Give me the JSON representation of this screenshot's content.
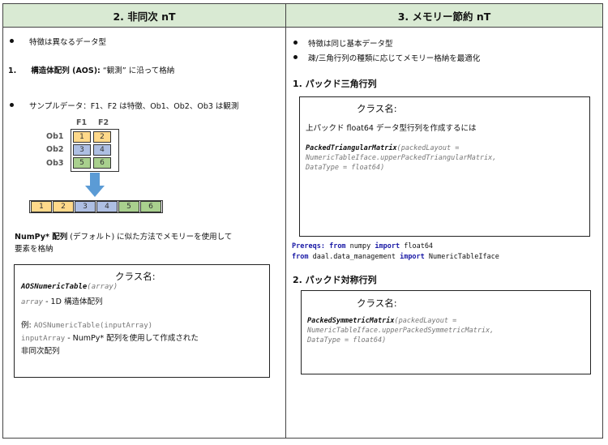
{
  "left": {
    "header": "2.  非同次 nT",
    "bullet1": "特徴は異なるデータ型",
    "item1_prefix": "1.",
    "item1_bold": "構造体配列 (AOS):",
    "item1_rest": " “観測” に沿って格納",
    "bullet2": "サンプルデータ：F1、F2 は特徴、Ob1、Ob2、Ob3 は観測",
    "col_labels": [
      "F1",
      "F2"
    ],
    "row_labels": [
      "Ob1",
      "Ob2",
      "Ob3"
    ],
    "grid": [
      [
        "1",
        "2"
      ],
      [
        "3",
        "4"
      ],
      [
        "5",
        "6"
      ]
    ],
    "strip": [
      "1",
      "2",
      "3",
      "4",
      "5",
      "6"
    ],
    "numpy_bold": "NumPy* 配列",
    "numpy_rest": " (デフォルト) に似た方法でメモリーを使用して",
    "numpy_line2": "要素を格納",
    "box": {
      "title": "クラス名:",
      "sig_name": "AOSNumericTable",
      "sig_args": "(array)",
      "param_name": "array",
      "param_desc": " - 1D 構造体配列",
      "example_label": "例: ",
      "example_code": "AOSNumericTable(inputArray)",
      "example_param": "inputArray",
      "example_desc": " - NumPy* 配列を使用して作成された",
      "example_desc2": "非同次配列"
    }
  },
  "right": {
    "header": "3.  メモリー節約 nT",
    "bullet1": "特徴は同じ基本データ型",
    "bullet2": "疎/三角行列の種類に応じてメモリー格納を最適化",
    "sec1_title": "1.   パックド三角行列",
    "box1": {
      "title": "クラス名:",
      "desc": "上パックド float64 データ型行列を作成するには",
      "sig_name": "PackedTriangularMatrix",
      "sig_line1": "(packedLayout =",
      "sig_line2": "NumericTableIface.upperPackedTriangularMatrix,",
      "sig_line3": "DataType = float64)"
    },
    "prereqs": {
      "label": "Prereqs:",
      "from1": "from",
      "mod1": " numpy ",
      "import1": "import",
      "name1": " float64",
      "from2": "from",
      "mod2": " daal.data_management ",
      "import2": "import",
      "name2": "  NumericTableIface"
    },
    "sec2_title": "2.   パックド対称行列",
    "box2": {
      "title": "クラス名:",
      "sig_name": "PackedSymmetricMatrix",
      "sig_line1": "(packedLayout =",
      "sig_line2": "NumericTableIface.upperPackedSymmetricMatrix,",
      "sig_line3": "DataType = float64)"
    }
  },
  "colors": {
    "header_bg": "#d9ead3",
    "yellow": "#ffd98a",
    "blue": "#aebfe3",
    "green": "#a9d08e",
    "arrow": "#5b9bd5"
  }
}
